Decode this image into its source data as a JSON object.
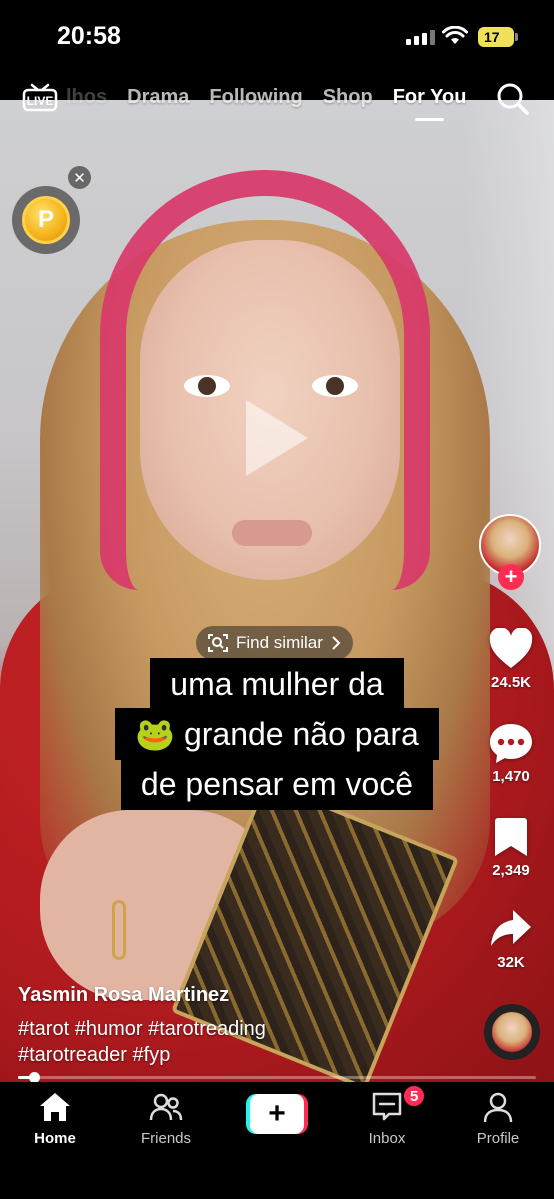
{
  "status_bar": {
    "time": "20:58",
    "battery": "17"
  },
  "top_nav": {
    "live_label": "LIVE",
    "tabs": [
      {
        "label": "lhos",
        "state": "partial"
      },
      {
        "label": "Drama",
        "state": "inactive"
      },
      {
        "label": "Following",
        "state": "inactive"
      },
      {
        "label": "Shop",
        "state": "inactive"
      },
      {
        "label": "For You",
        "state": "active"
      }
    ],
    "search_icon": "search-icon"
  },
  "coin_widget": {
    "symbol": "P",
    "close_glyph": "✕"
  },
  "find_similar": {
    "label": "Find similar"
  },
  "caption": {
    "lines": [
      "uma mulher da",
      "🐸 grande não para",
      "de pensar em você"
    ]
  },
  "video_meta": {
    "username": "Yasmin Rosa Martinez",
    "hashtags_line1": "#tarot #humor #tarotreading",
    "hashtags_line2": "#tarotreader #fyp",
    "progress": 0.03
  },
  "actions": {
    "follow_glyph": "+",
    "likes": "24.5K",
    "comments": "1,470",
    "saves": "2,349",
    "shares": "32K"
  },
  "bottom_nav": {
    "items": [
      {
        "label": "Home",
        "icon": "home-icon",
        "active": true
      },
      {
        "label": "Friends",
        "icon": "friends-icon",
        "active": false
      },
      {
        "label": "",
        "icon": "create-icon",
        "active": false
      },
      {
        "label": "Inbox",
        "icon": "inbox-icon",
        "active": false
      },
      {
        "label": "Profile",
        "icon": "profile-icon",
        "active": false
      }
    ],
    "create_glyph": "+",
    "inbox_badge": "5"
  },
  "colors": {
    "accent": "#fe2c55",
    "cyan": "#25f4ee",
    "battery": "#f1e15a"
  }
}
